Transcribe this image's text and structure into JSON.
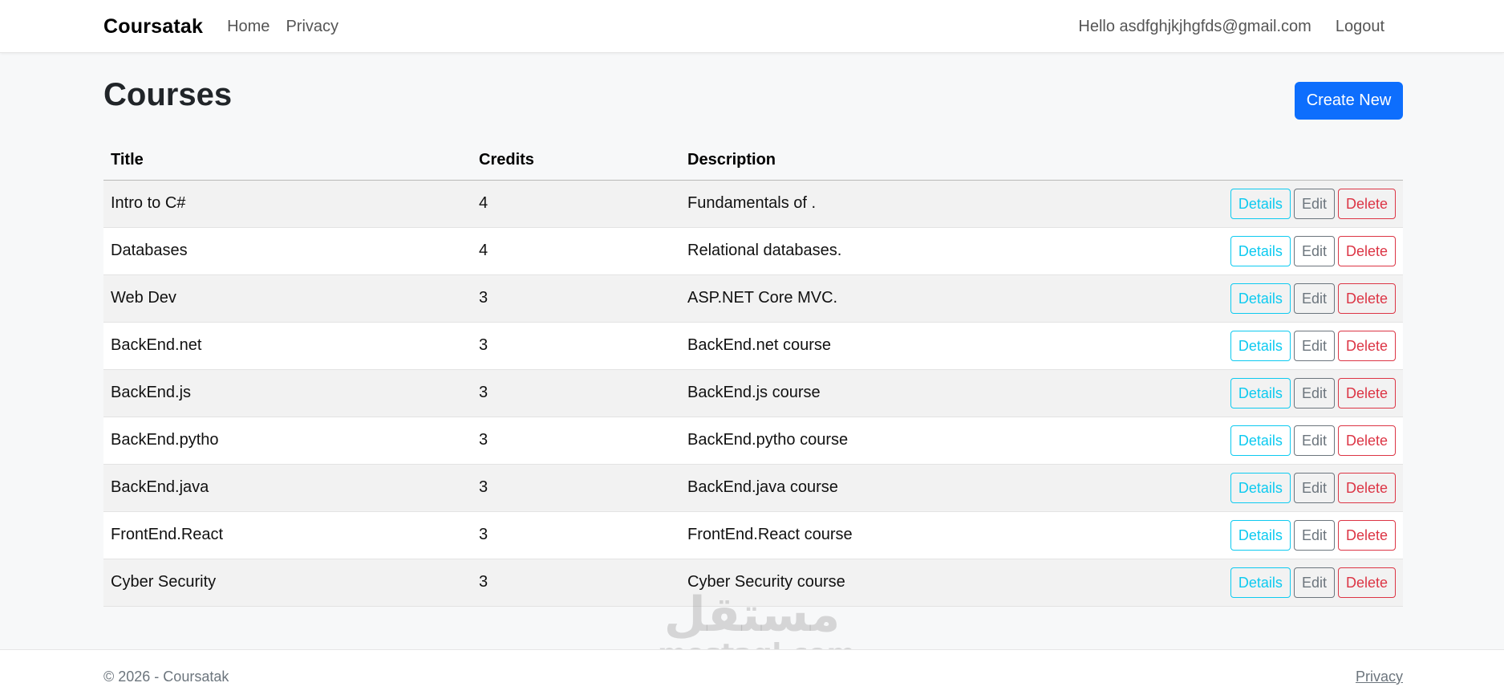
{
  "navbar": {
    "brand": "Coursatak",
    "links": [
      "Home",
      "Privacy"
    ],
    "user_greeting": "Hello asdfghjkjhgfds@gmail.com",
    "logout_label": "Logout"
  },
  "main": {
    "title": "Courses",
    "create_label": "Create New",
    "table": {
      "columns": [
        "Title",
        "Credits",
        "Description",
        ""
      ],
      "action_labels": {
        "details": "Details",
        "edit": "Edit",
        "delete": "Delete"
      },
      "rows": [
        {
          "title": "Intro to C#",
          "credits": "4",
          "description": "Fundamentals of ."
        },
        {
          "title": "Databases",
          "credits": "4",
          "description": "Relational databases."
        },
        {
          "title": "Web Dev",
          "credits": "3",
          "description": "ASP.NET Core MVC."
        },
        {
          "title": "BackEnd.net",
          "credits": "3",
          "description": "BackEnd.net course"
        },
        {
          "title": "BackEnd.js",
          "credits": "3",
          "description": "BackEnd.js course"
        },
        {
          "title": "BackEnd.pytho",
          "credits": "3",
          "description": "BackEnd.pytho course"
        },
        {
          "title": "BackEnd.java",
          "credits": "3",
          "description": "BackEnd.java course"
        },
        {
          "title": "FrontEnd.React",
          "credits": "3",
          "description": "FrontEnd.React course"
        },
        {
          "title": "Cyber Security",
          "credits": "3",
          "description": "Cyber Security course"
        }
      ]
    }
  },
  "footer": {
    "copyright": "© 2026 - Coursatak",
    "privacy_label": "Privacy"
  },
  "watermark": {
    "arabic": "مستقل",
    "latin": "mostaql.com"
  },
  "colors": {
    "primary": "#0d6efd",
    "info": "#0dcaf0",
    "secondary": "#6c757d",
    "danger": "#dc3545"
  }
}
